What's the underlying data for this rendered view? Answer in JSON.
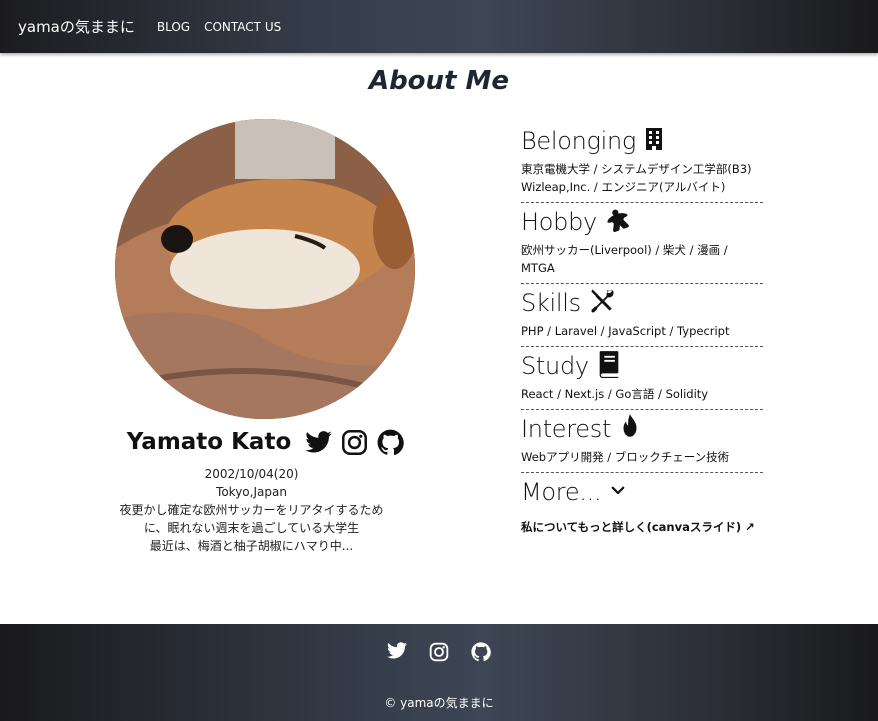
{
  "nav": {
    "brand": "yamaの気ままに",
    "links": [
      "BLOG",
      "CONTACT US"
    ]
  },
  "page_title": "About Me",
  "profile": {
    "name": "Yamato Kato",
    "birthday": "2002/10/04(20)",
    "location": "Tokyo,Japan",
    "bio_line1": "夜更かし確定な欧州サッカーをリアタイするため",
    "bio_line2": "に、眠れない週末を過ごしている大学生",
    "bio_line3": "最近は、梅酒と柚子胡椒にハマり中...",
    "sns_icons": [
      "twitter-icon",
      "instagram-icon",
      "github-icon"
    ]
  },
  "sections": [
    {
      "title": "Belonging",
      "icon": "building-icon",
      "lines": [
        "東京電機大学 / システムデザイン工学部(B3)",
        "Wizleap,Inc. / エンジニア(アルバイト)"
      ]
    },
    {
      "title": "Hobby",
      "icon": "meeple-icon",
      "lines": [
        "欧州サッカー(Liverpool) / 柴犬 / 漫画 / MTGA"
      ]
    },
    {
      "title": "Skills",
      "icon": "tools-icon",
      "lines": [
        "PHP / Laravel / JavaScript / Typecript"
      ]
    },
    {
      "title": "Study",
      "icon": "book-icon",
      "lines": [
        "React / Next.js / Go言語 / Solidity"
      ]
    },
    {
      "title": "Interest",
      "icon": "fire-icon",
      "lines": [
        "Webアプリ開発 / ブロックチェーン技術"
      ]
    },
    {
      "title": "More...",
      "icon": "chevron-down-icon",
      "lines": []
    }
  ],
  "more_link": "私についてもっと詳しく(canvaスライド) ↗",
  "footer": {
    "icons": [
      "twitter-icon",
      "instagram-icon",
      "github-icon"
    ],
    "copyright": "© yamaの気ままに"
  },
  "colors": {
    "header_bg": "#2f3541",
    "title_color": "#1f2533"
  }
}
